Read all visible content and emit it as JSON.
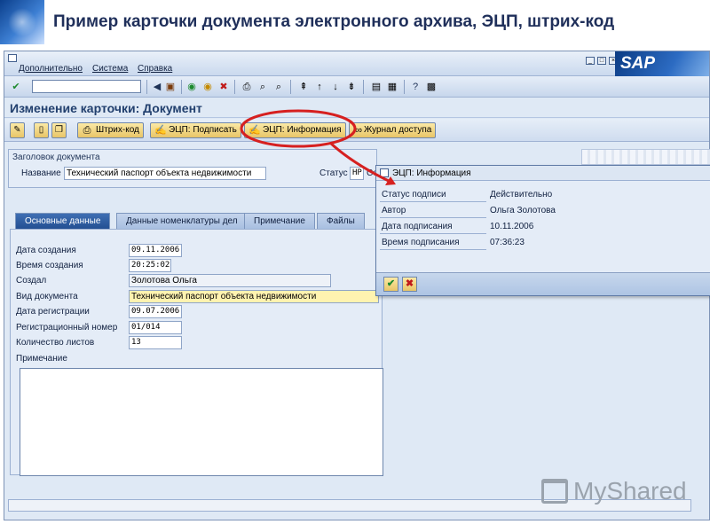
{
  "slide": {
    "title": "Пример карточки документа электронного архива, ЭЦП, штрих-код"
  },
  "menu": {
    "items": [
      "Дополнительно",
      "Система",
      "Справка"
    ],
    "brand": "SAP"
  },
  "page": {
    "title": "Изменение карточки: Документ"
  },
  "toolbar": {
    "barcode_label": "Штрих-код",
    "sign_label": "ЭЦП: Подписать",
    "info_label": "ЭЦП: Информация",
    "access_log_label": "Журнал доступа"
  },
  "header_group": {
    "title": "Заголовок документа",
    "name_label": "Название",
    "name_value": "Технический паспорт объекта недвижимости",
    "status_label": "Статус",
    "status_value": "НР"
  },
  "tabs": [
    "Основные данные",
    "Данные номенклатуры дел",
    "Примечание",
    "Файлы"
  ],
  "main_fields": [
    {
      "label": "Дата создания",
      "value": "09.11.2006"
    },
    {
      "label": "Время создания",
      "value": "20:25:02"
    },
    {
      "label": "Создал",
      "value": "Золотова Ольга"
    },
    {
      "label": "Вид документа",
      "value": "Технический паспорт объекта недвижимости"
    },
    {
      "label": "Дата регистрации",
      "value": "09.07.2006"
    },
    {
      "label": "Регистрационный номер",
      "value": "01/014"
    },
    {
      "label": "Количество листов",
      "value": "13"
    }
  ],
  "note_label": "Примечание",
  "popup": {
    "title": "ЭЦП: Информация",
    "rows": [
      {
        "label": "Статус подписи",
        "value": "Действительно"
      },
      {
        "label": "Автор",
        "value": "Ольга Золотова"
      },
      {
        "label": "Дата подписания",
        "value": "10.11.2006"
      },
      {
        "label": "Время подписания",
        "value": "07:36:23"
      }
    ]
  },
  "watermark": "MyShared",
  "colors": {
    "title": "#1f2f5a",
    "sap_frame": "#dfe9f5",
    "active_tab": "#234f92",
    "highlight_circle": "#d62020",
    "button_yellow": "#e8c567"
  }
}
